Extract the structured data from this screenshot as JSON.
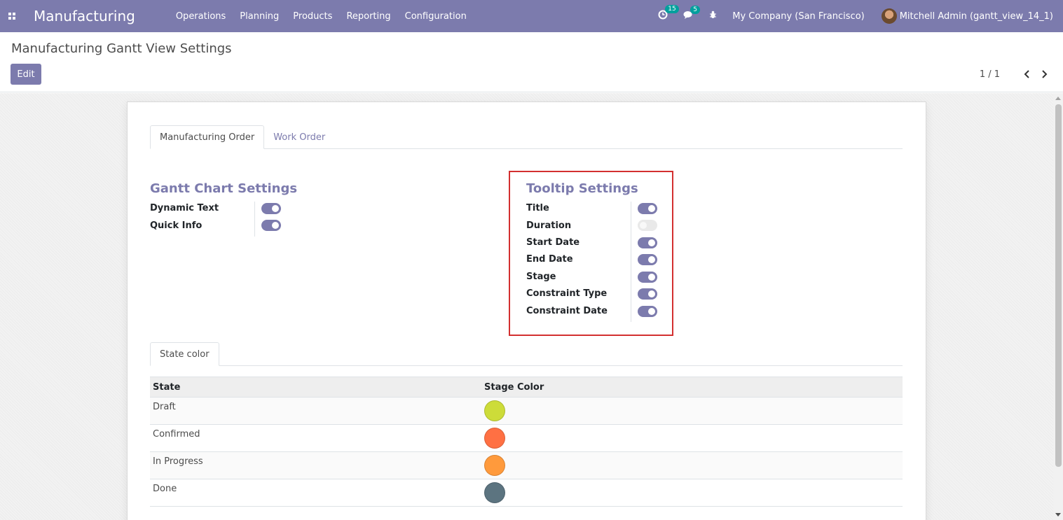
{
  "navbar": {
    "app_name": "Manufacturing",
    "menu": [
      "Operations",
      "Planning",
      "Products",
      "Reporting",
      "Configuration"
    ],
    "activity_count": "15",
    "messages_count": "5",
    "company": "My Company (San Francisco)",
    "user": "Mitchell Admin (gantt_view_14_1)"
  },
  "control_panel": {
    "breadcrumb": "Manufacturing Gantt View Settings",
    "edit_label": "Edit",
    "pager_value": "1 / 1",
    "pager_prev": "<",
    "pager_next": ">"
  },
  "tabs": [
    "Manufacturing Order",
    "Work Order"
  ],
  "gantt_settings": {
    "title": "Gantt Chart Settings",
    "fields": [
      {
        "label": "Dynamic Text",
        "enabled": true
      },
      {
        "label": "Quick Info",
        "enabled": true
      }
    ]
  },
  "tooltip_settings": {
    "title": "Tooltip Settings",
    "fields": [
      {
        "label": "Title",
        "enabled": true
      },
      {
        "label": "Duration",
        "enabled": false
      },
      {
        "label": "Start Date",
        "enabled": true
      },
      {
        "label": "End Date",
        "enabled": true
      },
      {
        "label": "Stage",
        "enabled": true
      },
      {
        "label": "Constraint Type",
        "enabled": true
      },
      {
        "label": "Constraint Date",
        "enabled": true
      }
    ]
  },
  "state_color": {
    "tab_label": "State color",
    "columns": [
      "State",
      "Stage Color"
    ],
    "rows": [
      {
        "state": "Draft",
        "color": "#cddc39"
      },
      {
        "state": "Confirmed",
        "color": "#ff7043"
      },
      {
        "state": "In Progress",
        "color": "#ff9a3c"
      },
      {
        "state": "Done",
        "color": "#5c7480"
      }
    ]
  },
  "colors": {
    "brand": "#7c7bad",
    "highlight": "#d32f2f"
  }
}
